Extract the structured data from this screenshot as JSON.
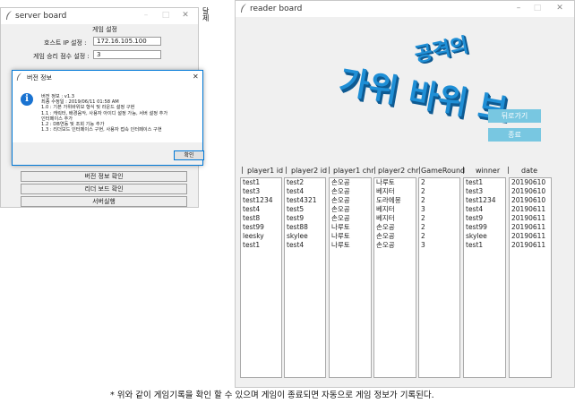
{
  "server_window": {
    "title": "server board",
    "section_title": "게임 설정",
    "host_ip_label": "호스트 IP 설정 :",
    "host_ip_value": "172.16.105.100",
    "win_score_label": "게임 승리 점수 설정 :",
    "win_score_value": "3",
    "buttons": [
      "버전 정보 확인",
      "리더 보드 확인",
      "서버실행"
    ]
  },
  "dialog": {
    "title": "버전 정보",
    "lines": [
      "버전 정보 : v1.3",
      "최종 수정일 : 2019/06/11 01:58 AM",
      "1.0 : 기본 가위바위보 형식 및 라운드 설정 구현",
      "1.1 : 캐릭터, 배경음악, 사용자 아이디 설정 가능, 서버 설정 추가",
      "인터페이스 추가",
      "1.2 : DB연동 및 조회 기능 추가",
      "1.3 : 리더보드 인터페이스 구현, 사용자 접속 인터페이스 구현"
    ],
    "ok_label": "확인"
  },
  "bg_text": "달\n제",
  "reader_window": {
    "title": "reader board",
    "logo_small": "공격의",
    "logo_large": "가위 바위 보",
    "back_button": "뒤로가기",
    "exit_button": "종료",
    "columns": [
      "player1 id",
      "player2 id",
      "player1 chr",
      "player2 chr",
      "GameRound",
      "winner",
      "date"
    ],
    "rows": [
      [
        "test1",
        "test2",
        "손오공",
        "나루토",
        "2",
        "test1",
        "20190610"
      ],
      [
        "test3",
        "test4",
        "손오공",
        "베지터",
        "2",
        "test3",
        "20190610"
      ],
      [
        "test1234",
        "test4321",
        "손오공",
        "도라에몽",
        "2",
        "test1234",
        "20190610"
      ],
      [
        "test4",
        "test5",
        "손오공",
        "베지터",
        "3",
        "test4",
        "20190611"
      ],
      [
        "test8",
        "test9",
        "손오공",
        "베지터",
        "2",
        "test9",
        "20190611"
      ],
      [
        "test99",
        "test88",
        "나루토",
        "손오공",
        "2",
        "test99",
        "20190611"
      ],
      [
        "leesky",
        "skylee",
        "나루토",
        "손오공",
        "2",
        "skylee",
        "20190611"
      ],
      [
        "test1",
        "test4",
        "나루토",
        "손오공",
        "3",
        "test1",
        "20190611"
      ]
    ]
  },
  "footnote": "* 위와 같이 게임기록을 확인 할 수 있으며 게임이 종료되면 자동으로 게임 정보가 기록된다.",
  "colors": {
    "logo_blue": "#1f8fd6",
    "button_blue": "#78c7e1",
    "reader_bg": "#f0f0f0",
    "info_icon": "#1a73d1"
  },
  "icons": {
    "app": "feather-icon",
    "info": "info-icon",
    "minimize": "minimize-icon",
    "maximize": "maximize-icon",
    "close": "close-icon"
  }
}
